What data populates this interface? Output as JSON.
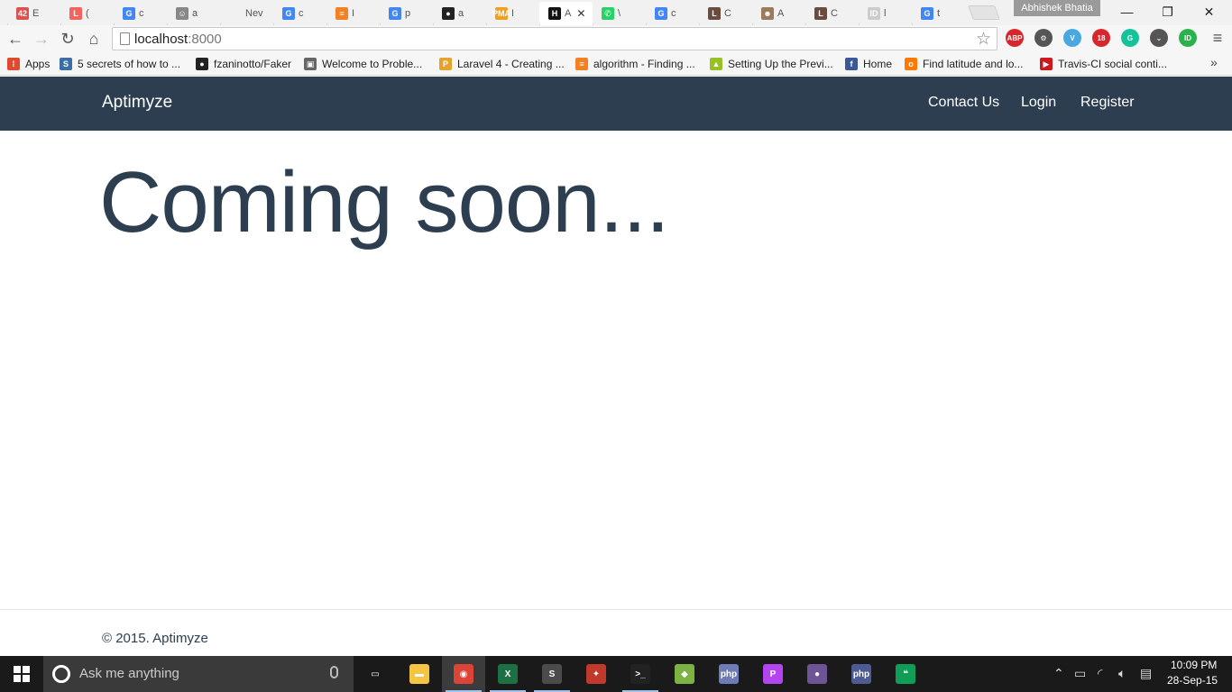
{
  "browser": {
    "tabs": [
      {
        "icon": "badge-42-icon",
        "title": "E",
        "color": "#d9534f",
        "glyph": "42"
      },
      {
        "icon": "laravel-icon",
        "title": "(",
        "color": "#f4645f",
        "glyph": "L"
      },
      {
        "icon": "google-icon",
        "title": "c",
        "color": "#4285f4",
        "glyph": "G"
      },
      {
        "icon": "github-cat-icon",
        "title": "a",
        "color": "#888888",
        "glyph": "☺"
      },
      {
        "icon": "blank-page-icon",
        "title": "Nev",
        "color": "#f1f1f1",
        "glyph": ""
      },
      {
        "icon": "google-icon",
        "title": "c",
        "color": "#4285f4",
        "glyph": "G"
      },
      {
        "icon": "stackoverflow-icon",
        "title": "I",
        "color": "#f48024",
        "glyph": "≡"
      },
      {
        "icon": "google-icon",
        "title": "p",
        "color": "#4285f4",
        "glyph": "G"
      },
      {
        "icon": "github-icon",
        "title": "a",
        "color": "#222222",
        "glyph": "●"
      },
      {
        "icon": "phpmyadmin-icon",
        "title": "I",
        "color": "#f0a01e",
        "glyph": "PMA"
      },
      {
        "icon": "h-icon",
        "title": "A",
        "color": "#111111",
        "glyph": "H",
        "active": true
      },
      {
        "icon": "whatsapp-icon",
        "title": "\\",
        "color": "#25d366",
        "glyph": "✆"
      },
      {
        "icon": "google-icon",
        "title": "c",
        "color": "#4285f4",
        "glyph": "G"
      },
      {
        "icon": "laravel-l-icon",
        "title": "C",
        "color": "#6b4b3e",
        "glyph": "L"
      },
      {
        "icon": "person-icon",
        "title": "A",
        "color": "#9a7b5e",
        "glyph": "☻"
      },
      {
        "icon": "laravel-l-icon",
        "title": "C",
        "color": "#6b4b3e",
        "glyph": "L"
      },
      {
        "icon": "id-card-icon",
        "title": "l",
        "color": "#cccccc",
        "glyph": "ID"
      },
      {
        "icon": "google-icon",
        "title": "t",
        "color": "#4285f4",
        "glyph": "G"
      }
    ],
    "profile_name": "Abhishek Bhatia",
    "url_host": "localhost",
    "url_port": ":8000",
    "extensions": [
      {
        "icon": "adblock-icon",
        "label": "ABP",
        "color": "#d9262c"
      },
      {
        "icon": "gear-film-icon",
        "label": "⚙",
        "color": "#555555"
      },
      {
        "icon": "vimeo-icon",
        "label": "V",
        "color": "#4aa8e0"
      },
      {
        "icon": "calendar-badge-icon",
        "label": "18",
        "color": "#d9262c"
      },
      {
        "icon": "grammarly-icon",
        "label": "G",
        "color": "#15c39a"
      },
      {
        "icon": "pocket-icon",
        "label": "⌄",
        "color": "#555555"
      },
      {
        "icon": "id-green-icon",
        "label": "ID",
        "color": "#2bb24c"
      }
    ],
    "bookmarks": [
      {
        "icon": "apps-grid-icon",
        "label": "Apps",
        "color": "#e04a2f",
        "glyph": "⁞"
      },
      {
        "icon": "s-bookmark-icon",
        "label": "5 secrets of how to ...",
        "color": "#3a6ea5",
        "glyph": "S"
      },
      {
        "icon": "github-icon",
        "label": "fzaninotto/Faker",
        "color": "#222222",
        "glyph": "●"
      },
      {
        "icon": "doc-bookmark-icon",
        "label": "Welcome to Proble...",
        "color": "#666666",
        "glyph": "▣"
      },
      {
        "icon": "p-bookmark-icon",
        "label": "Laravel 4 - Creating ...",
        "color": "#e7a22b",
        "glyph": "P"
      },
      {
        "icon": "stackoverflow-icon",
        "label": "algorithm - Finding ...",
        "color": "#f48024",
        "glyph": "≡"
      },
      {
        "icon": "android-icon",
        "label": "Setting Up the Previ...",
        "color": "#97c024",
        "glyph": "▲"
      },
      {
        "icon": "facebook-icon",
        "label": "Home",
        "color": "#3b5998",
        "glyph": "f"
      },
      {
        "icon": "orange-icon",
        "label": "Find latitude and lo...",
        "color": "#ff7900",
        "glyph": "o"
      },
      {
        "icon": "youtube-icon",
        "label": "Travis-CI social conti...",
        "color": "#cc181e",
        "glyph": "▶"
      }
    ]
  },
  "site": {
    "brand": "Aptimyze",
    "nav": {
      "contact": "Contact Us",
      "login": "Login",
      "register": "Register"
    },
    "headline": "Coming soon...",
    "footer": "© 2015. Aptimyze",
    "colors": {
      "navbar": "#2c3e50",
      "text": "#2c3e50"
    }
  },
  "taskbar": {
    "search_placeholder": "Ask me anything",
    "apps": [
      {
        "icon": "task-view-icon",
        "color": "transparent",
        "glyph": "▭"
      },
      {
        "icon": "file-explorer-icon",
        "color": "#f4c542",
        "glyph": "▬"
      },
      {
        "icon": "chrome-icon",
        "color": "#db4437",
        "glyph": "◉",
        "running": true,
        "active": true
      },
      {
        "icon": "excel-icon",
        "color": "#1d7044",
        "glyph": "X",
        "running": true
      },
      {
        "icon": "sublime-text-icon",
        "color": "#4b4b4b",
        "glyph": "S",
        "running": true
      },
      {
        "icon": "popcorn-icon",
        "color": "#c0392b",
        "glyph": "✦"
      },
      {
        "icon": "terminal-icon",
        "color": "#222222",
        "glyph": ">_",
        "running": true
      },
      {
        "icon": "bluestacks-icon",
        "color": "#7cb342",
        "glyph": "◆"
      },
      {
        "icon": "php-icon",
        "color": "#6f7bb6",
        "glyph": "php"
      },
      {
        "icon": "phpstorm-icon",
        "color": "#b345f1",
        "glyph": "P"
      },
      {
        "icon": "github-desktop-icon",
        "color": "#6e5494",
        "glyph": "●"
      },
      {
        "icon": "php-storm-alt-icon",
        "color": "#4e5b93",
        "glyph": "php"
      },
      {
        "icon": "hangouts-icon",
        "color": "#0f9d58",
        "glyph": "❝"
      }
    ],
    "clock_time": "10:09 PM",
    "clock_date": "28-Sep-15"
  }
}
